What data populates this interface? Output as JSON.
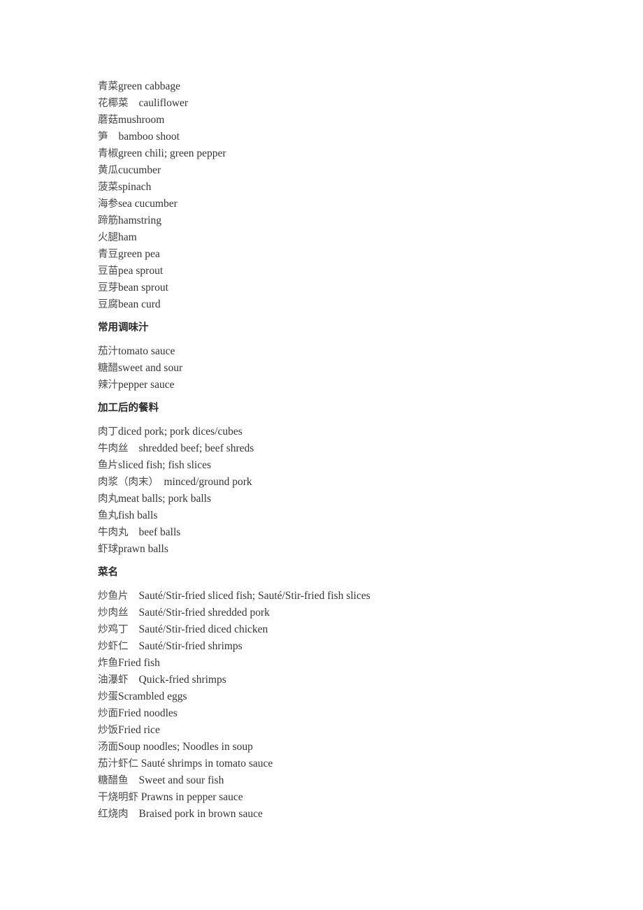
{
  "document": {
    "page_background": "#ffffff",
    "text_color": "#3a3a3a",
    "blocks": [
      {
        "type": "entries",
        "name": "vegetables-and-ingredients-list",
        "items": [
          {
            "cn": "青菜",
            "gap": "",
            "en": "green cabbage"
          },
          {
            "cn": "花椰菜",
            "gap": "    ",
            "en": "cauliflower"
          },
          {
            "cn": "蘑菇",
            "gap": "",
            "en": "mushroom"
          },
          {
            "cn": "笋",
            "gap": "    ",
            "en": "bamboo shoot"
          },
          {
            "cn": "青椒",
            "gap": "",
            "en": "green chili; green pepper"
          },
          {
            "cn": "黄瓜",
            "gap": "",
            "en": "cucumber"
          },
          {
            "cn": "菠菜",
            "gap": "",
            "en": "spinach"
          },
          {
            "cn": "海参",
            "gap": "",
            "en": "sea cucumber"
          },
          {
            "cn": "蹄筋",
            "gap": "",
            "en": "hamstring"
          },
          {
            "cn": "火腿",
            "gap": "",
            "en": "ham"
          },
          {
            "cn": "青豆",
            "gap": "",
            "en": "green pea"
          },
          {
            "cn": "豆苗",
            "gap": "",
            "en": "pea sprout"
          },
          {
            "cn": "豆芽",
            "gap": "",
            "en": "bean sprout"
          },
          {
            "cn": "豆腐",
            "gap": "",
            "en": "bean curd"
          }
        ]
      },
      {
        "type": "heading",
        "name": "heading-common-sauces",
        "text": "常用调味汁"
      },
      {
        "type": "entries",
        "name": "common-sauces-list",
        "items": [
          {
            "cn": "茄汁",
            "gap": "",
            "en": "tomato sauce"
          },
          {
            "cn": "糖醋",
            "gap": "",
            "en": "sweet and sour"
          },
          {
            "cn": "辣汁",
            "gap": "",
            "en": "pepper sauce"
          }
        ]
      },
      {
        "type": "heading",
        "name": "heading-processed-ingredients",
        "text": "加工后的餐料"
      },
      {
        "type": "entries",
        "name": "processed-ingredients-list",
        "items": [
          {
            "cn": "肉丁",
            "gap": "",
            "en": "diced pork; pork dices/cubes"
          },
          {
            "cn": "牛肉丝",
            "gap": "    ",
            "en": "shredded beef; beef shreds"
          },
          {
            "cn": "鱼片",
            "gap": "",
            "en": "sliced fish; fish slices"
          },
          {
            "cn": "肉浆（肉末）",
            "gap": "  ",
            "en": "minced/ground pork"
          },
          {
            "cn": "肉丸",
            "gap": "",
            "en": "meat balls; pork balls"
          },
          {
            "cn": "鱼丸",
            "gap": "",
            "en": "fish balls"
          },
          {
            "cn": "牛肉丸",
            "gap": "    ",
            "en": "beef balls"
          },
          {
            "cn": "虾球",
            "gap": "",
            "en": "prawn balls"
          }
        ]
      },
      {
        "type": "heading",
        "name": "heading-dish-names",
        "text": "菜名"
      },
      {
        "type": "entries",
        "name": "dish-names-list",
        "items": [
          {
            "cn": "炒鱼片",
            "gap": "    ",
            "en": "Sauté/Stir-fried sliced fish; Sauté/Stir-fried fish slices"
          },
          {
            "cn": "炒肉丝",
            "gap": "    ",
            "en": "Sauté/Stir-fried shredded pork"
          },
          {
            "cn": "炒鸡丁",
            "gap": "    ",
            "en": "Sauté/Stir-fried diced chicken"
          },
          {
            "cn": "炒虾仁",
            "gap": "    ",
            "en": "Sauté/Stir-fried shrimps"
          },
          {
            "cn": "炸鱼",
            "gap": "",
            "en": "Fried fish"
          },
          {
            "cn": "油瀑虾",
            "gap": "    ",
            "en": "Quick-fried shrimps"
          },
          {
            "cn": "炒蛋",
            "gap": "",
            "en": "Scrambled eggs"
          },
          {
            "cn": "炒面",
            "gap": "",
            "en": "Fried noodles"
          },
          {
            "cn": "炒饭",
            "gap": "",
            "en": "Fried rice"
          },
          {
            "cn": "汤面",
            "gap": "",
            "en": "Soup noodles; Noodles in soup"
          },
          {
            "cn": "茄汁虾仁",
            "gap": " ",
            "en": "Sauté shrimps in tomato sauce"
          },
          {
            "cn": "糖醋鱼",
            "gap": "    ",
            "en": "Sweet and sour fish"
          },
          {
            "cn": "干烧明虾",
            "gap": " ",
            "en": "Prawns in pepper sauce"
          },
          {
            "cn": "红烧肉",
            "gap": "    ",
            "en": "Braised pork in brown sauce"
          }
        ]
      }
    ]
  }
}
